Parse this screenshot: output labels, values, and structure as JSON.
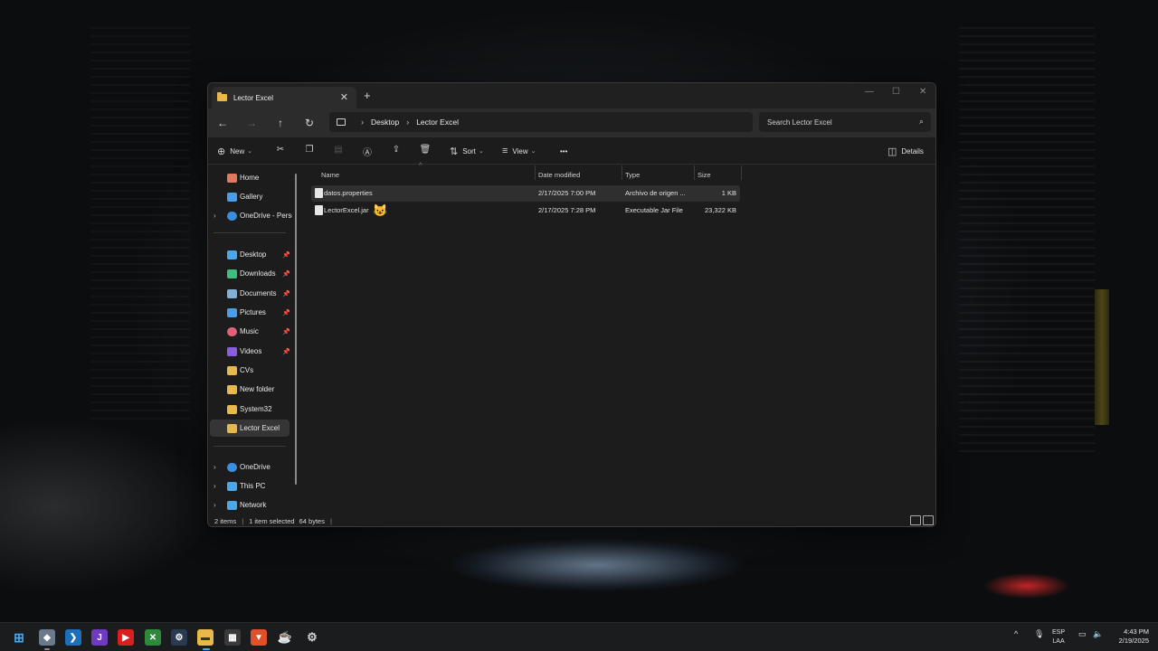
{
  "window": {
    "tab_title": "Lector Excel",
    "new_tab_label": "+",
    "minimize": "—",
    "maximize": "☐",
    "close": "✕"
  },
  "address": {
    "breadcrumbs": [
      "Desktop",
      "Lector Excel"
    ],
    "search_placeholder": "Search Lector Excel"
  },
  "toolbar": {
    "new_label": "New",
    "sort_label": "Sort",
    "view_label": "View",
    "more_label": "•••",
    "details_label": "Details",
    "icons": [
      "cut-icon",
      "copy-icon",
      "paste-icon",
      "rename-icon",
      "share-icon",
      "delete-icon"
    ]
  },
  "sidebar": {
    "items": [
      {
        "label": "Home",
        "icon": "home-icon",
        "color": "#e07a5f"
      },
      {
        "label": "Gallery",
        "icon": "gallery-icon",
        "color": "#4a9ee8"
      },
      {
        "label": "OneDrive - Personal",
        "icon": "cloud-icon",
        "color": "#3b8ede"
      },
      {
        "label": "Desktop",
        "icon": "desktop-icon",
        "color": "#4aa8e8"
      },
      {
        "label": "Downloads",
        "icon": "download-icon",
        "color": "#3fbf7f"
      },
      {
        "label": "Documents",
        "icon": "documents-icon",
        "color": "#7fb0d8"
      },
      {
        "label": "Pictures",
        "icon": "pictures-icon",
        "color": "#4a9ee8"
      },
      {
        "label": "Music",
        "icon": "music-icon",
        "color": "#e0607a"
      },
      {
        "label": "Videos",
        "icon": "videos-icon",
        "color": "#8a5ce0"
      },
      {
        "label": "CVs",
        "icon": "folder-icon",
        "color": "#e8b94a"
      },
      {
        "label": "New folder",
        "icon": "folder-icon",
        "color": "#e8b94a"
      },
      {
        "label": "System32",
        "icon": "folder-icon",
        "color": "#e8b94a"
      },
      {
        "label": "Lector Excel",
        "icon": "folder-icon",
        "color": "#e8b94a"
      },
      {
        "label": "OneDrive",
        "icon": "cloud-icon",
        "color": "#3b8ede"
      },
      {
        "label": "This PC",
        "icon": "pc-icon",
        "color": "#4aa8e8"
      },
      {
        "label": "Network",
        "icon": "network-icon",
        "color": "#4aa8e8"
      }
    ]
  },
  "columns": [
    "Name",
    "Date modified",
    "Type",
    "Size"
  ],
  "files": [
    {
      "name": "datos.properties",
      "date": "2/17/2025 7:00 PM",
      "type": "Archivo de origen ...",
      "size": "1 KB"
    },
    {
      "name": "LectorExcel.jar",
      "date": "2/17/2025 7:28 PM",
      "type": "Executable Jar File",
      "size": "23,322 KB"
    }
  ],
  "status": {
    "count": "2 items",
    "selection": "1 item selected",
    "bytes": "64 bytes"
  },
  "taskbar": {
    "lang_line1": "ESP",
    "lang_line2": "LAA",
    "time": "4:43 PM",
    "date": "2/19/2025"
  }
}
